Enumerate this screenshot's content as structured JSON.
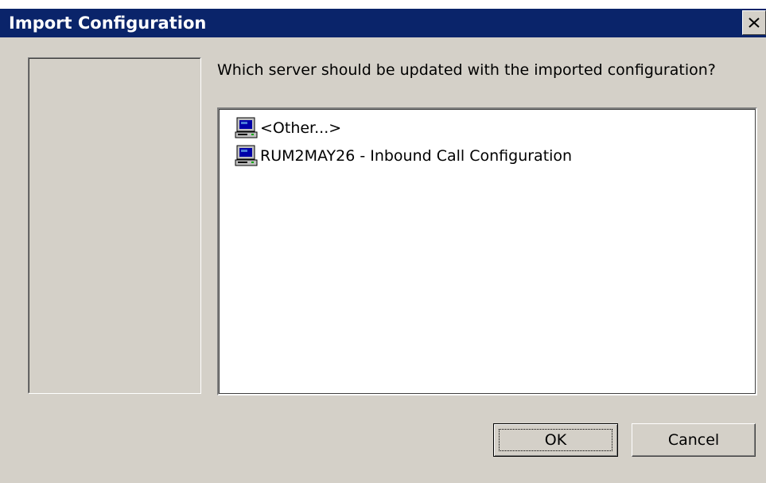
{
  "dialog": {
    "title": "Import Configuration",
    "close_icon": "close-icon",
    "prompt": "Which server should be updated with the imported configuration?",
    "servers": [
      {
        "label": "<Other...>",
        "icon": "computer-icon"
      },
      {
        "label": "RUM2MAY26 - Inbound Call Configuration",
        "icon": "computer-icon"
      }
    ],
    "ok_label": "OK",
    "cancel_label": "Cancel"
  },
  "colors": {
    "titlebar": "#0a246a",
    "face": "#d4d0c8",
    "list_background": "#ffffff"
  }
}
